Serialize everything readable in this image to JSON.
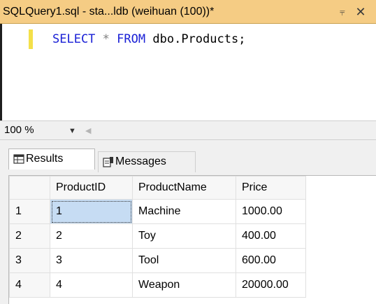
{
  "tab": {
    "title": "SQLQuery1.sql - sta...ldb (weihuan (100))*",
    "pin_icon": "pin-icon",
    "close_icon": "close-icon"
  },
  "editor": {
    "keyword_select": "SELECT",
    "star": "*",
    "keyword_from": "FROM",
    "rest": "dbo.Products;"
  },
  "zoom": {
    "value": "100 %"
  },
  "results_tabs": {
    "results_label": "Results",
    "messages_label": "Messages"
  },
  "grid": {
    "columns": [
      "ProductID",
      "ProductName",
      "Price"
    ],
    "rows": [
      {
        "num": "1",
        "ProductID": "1",
        "ProductName": "Machine",
        "Price": "1000.00"
      },
      {
        "num": "2",
        "ProductID": "2",
        "ProductName": "Toy",
        "Price": "400.00"
      },
      {
        "num": "3",
        "ProductID": "3",
        "ProductName": "Tool",
        "Price": "600.00"
      },
      {
        "num": "4",
        "ProductID": "4",
        "ProductName": "Weapon",
        "Price": "20000.00"
      }
    ]
  },
  "colors": {
    "tab_background": "#f5cc84",
    "keyword": "#1a20d6",
    "selection": "#c6dcf3"
  }
}
